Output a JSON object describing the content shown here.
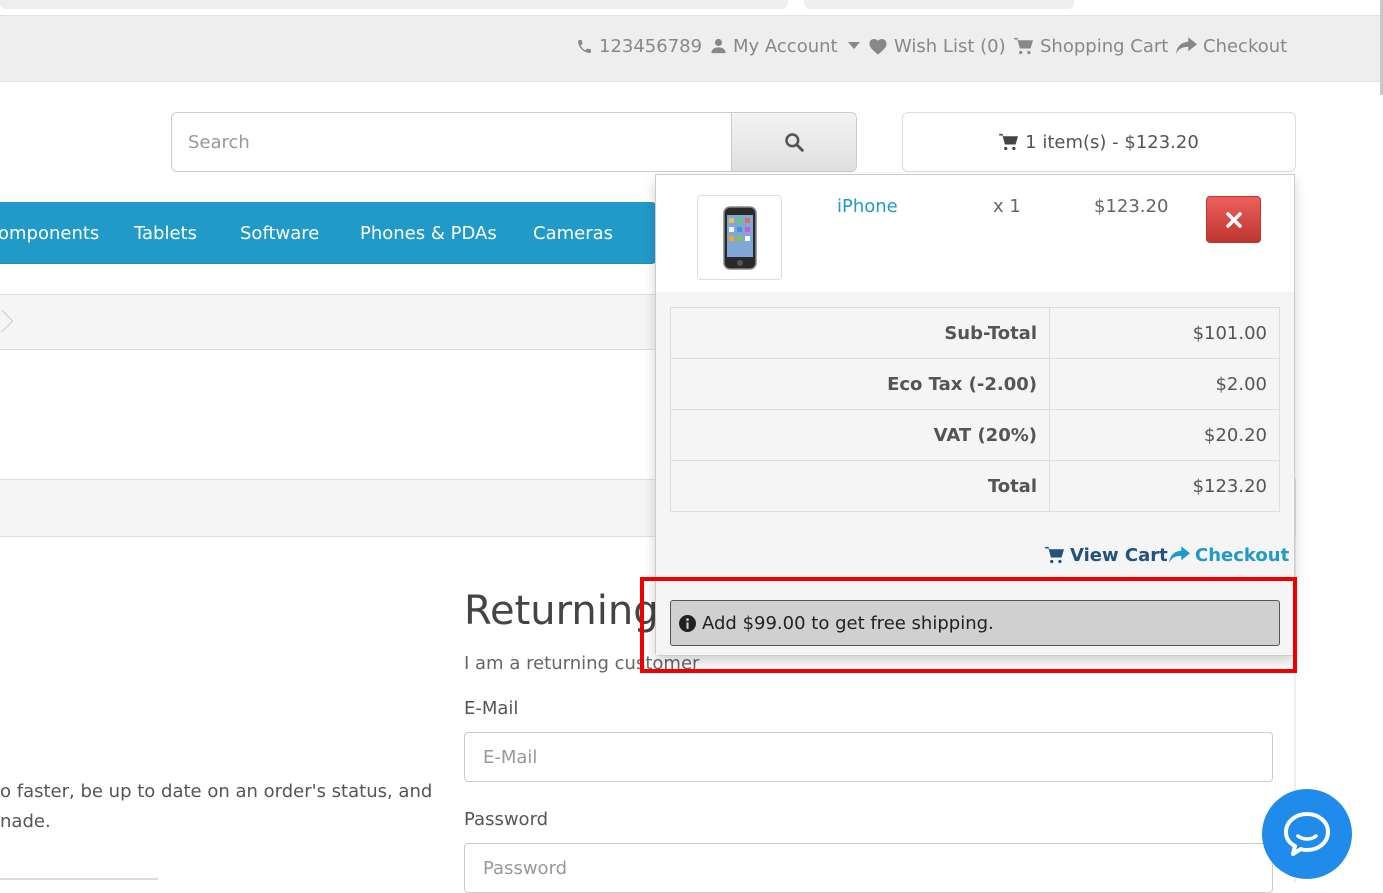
{
  "topbar": {
    "phone": "123456789",
    "my_account": "My Account",
    "wish_list": "Wish List (0)",
    "shopping_cart": "Shopping Cart",
    "checkout": "Checkout"
  },
  "search": {
    "placeholder": "Search"
  },
  "cart_button": {
    "label": "1 item(s) - $123.20"
  },
  "menu": {
    "items": [
      "omponents",
      "Tablets",
      "Software",
      "Phones & PDAs",
      "Cameras"
    ]
  },
  "cart_dropdown": {
    "product": {
      "name": "iPhone",
      "qty": "x 1",
      "price": "$123.20"
    },
    "totals": [
      {
        "label": "Sub-Total",
        "value": "$101.00"
      },
      {
        "label": "Eco Tax (-2.00)",
        "value": "$2.00"
      },
      {
        "label": "VAT (20%)",
        "value": "$20.20"
      },
      {
        "label": "Total",
        "value": "$123.20"
      }
    ],
    "view_cart": "View Cart",
    "checkout": "Checkout",
    "shipping_notice": "Add $99.00 to get free shipping."
  },
  "left_text": {
    "line1": "o faster, be up to date on an order's status, and",
    "line2": "nade."
  },
  "returning": {
    "title": "Returning",
    "subtitle": "I am a returning customer",
    "email_label": "E-Mail",
    "email_placeholder": "E-Mail",
    "password_label": "Password",
    "password_placeholder": "Password"
  },
  "colors": {
    "menu_bar": "#229ac8",
    "link": "#229ac8",
    "remove": "#da4f49",
    "highlight": "#ee0000",
    "chat": "#1f8ceb"
  }
}
